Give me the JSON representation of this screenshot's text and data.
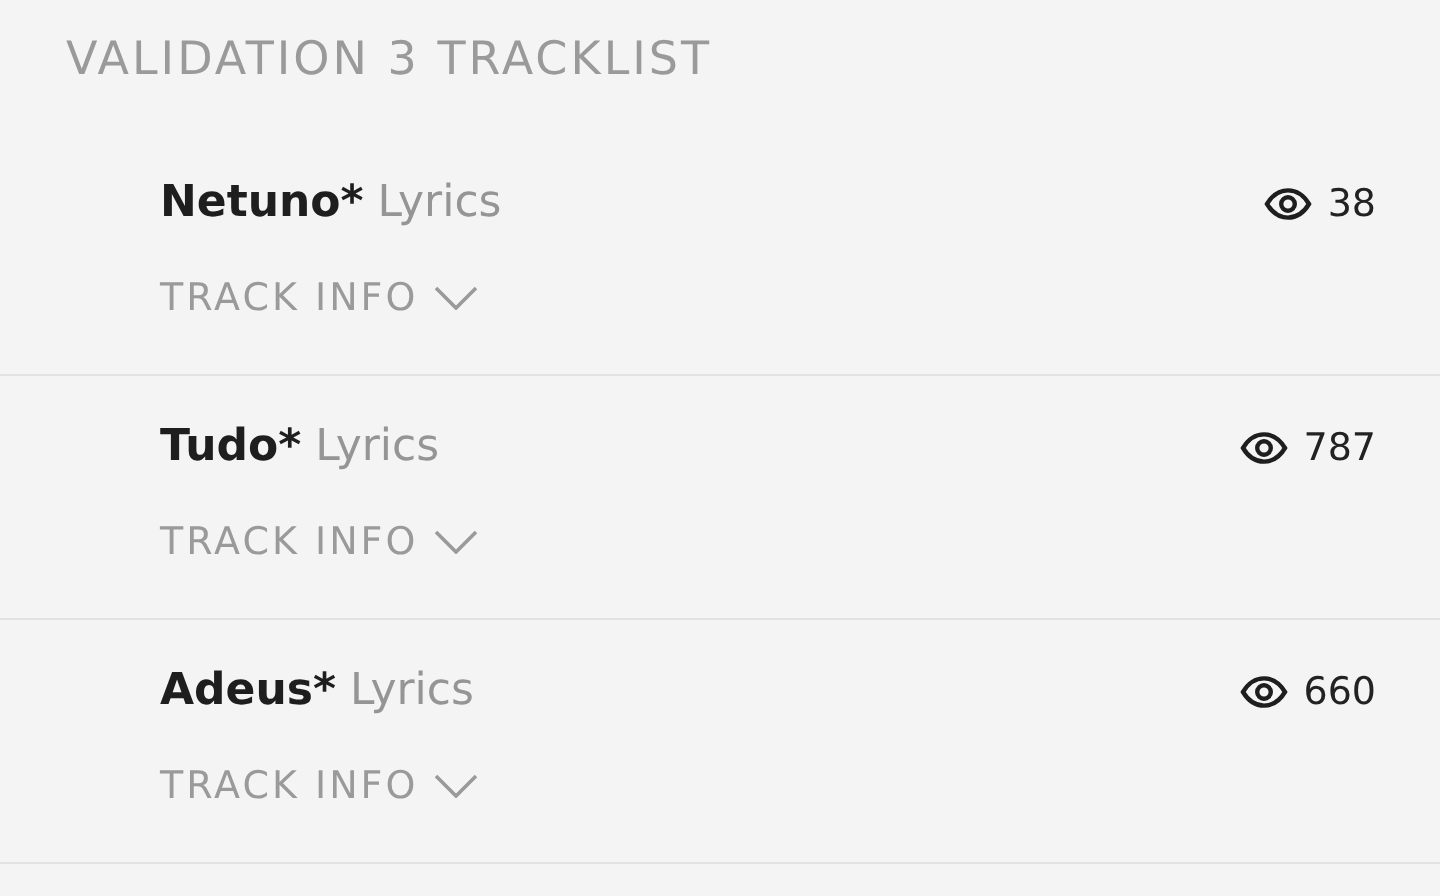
{
  "header": {
    "title": "VALIDATION 3 TRACKLIST"
  },
  "tracks": [
    {
      "title": "Netuno*",
      "suffix": "Lyrics",
      "views": "38",
      "info": {
        "label": "TRACK INFO",
        "expanded": false
      }
    },
    {
      "title": "Tudo*",
      "suffix": "Lyrics",
      "views": "787",
      "info": {
        "label": "TRACK INFO",
        "expanded": false
      }
    },
    {
      "title": "Adeus*",
      "suffix": "Lyrics",
      "views": "660",
      "info": {
        "label": "TRACK INFO",
        "expanded": false
      }
    }
  ]
}
